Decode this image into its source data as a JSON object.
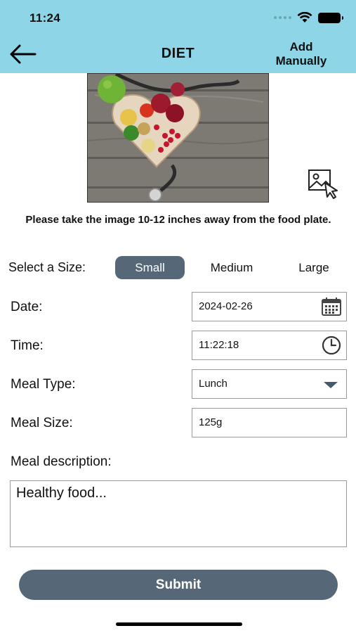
{
  "status_bar": {
    "time": "11:24"
  },
  "header": {
    "title": "DIET",
    "add_manually": "Add Manually",
    "background": "#8ed6e7"
  },
  "photo": {
    "subject": "heart-shaped bowl of vegetables and fruit with stethoscope"
  },
  "instruction": "Please take the image 10-12 inches away from the food plate.",
  "size_selector": {
    "label": "Select a Size:",
    "options": [
      "Small",
      "Medium",
      "Large"
    ],
    "selected": "Small",
    "selected_color": "#566878"
  },
  "form": {
    "date": {
      "label": "Date:",
      "value": "2024-02-26",
      "icon": "calendar-icon"
    },
    "time": {
      "label": "Time:",
      "value": "11:22:18",
      "icon": "clock-icon"
    },
    "meal_type": {
      "label": "Meal Type:",
      "value": "Lunch",
      "icon": "dropdown-caret-icon"
    },
    "meal_size": {
      "label": "Meal Size:",
      "value": "125g"
    },
    "meal_description": {
      "label": "Meal description:",
      "value": "Healthy food..."
    }
  },
  "submit": {
    "label": "Submit",
    "color": "#566878"
  }
}
